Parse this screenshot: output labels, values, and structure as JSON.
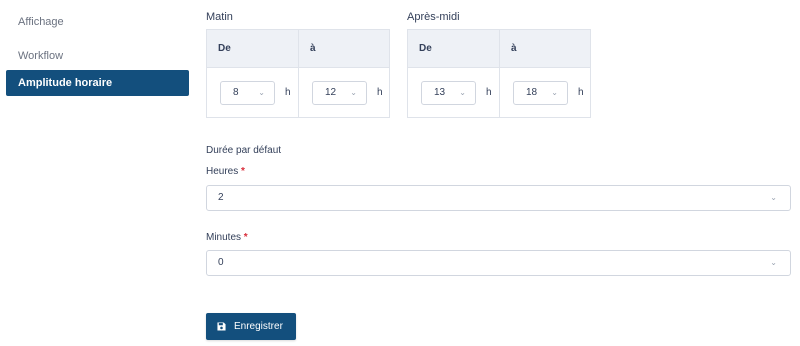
{
  "sidebar": {
    "items": [
      {
        "label": "Affichage",
        "active": false
      },
      {
        "label": "Workflow",
        "active": false
      },
      {
        "label": "Amplitude horaire",
        "active": true
      }
    ]
  },
  "schedule": {
    "morning": {
      "title": "Matin",
      "from_label": "De",
      "to_label": "à",
      "from_value": "8",
      "to_value": "12",
      "unit": "h"
    },
    "afternoon": {
      "title": "Après-midi",
      "from_label": "De",
      "to_label": "à",
      "from_value": "13",
      "to_value": "18",
      "unit": "h"
    }
  },
  "default_duration": {
    "title": "Durée par défaut",
    "hours": {
      "label": "Heures",
      "required_mark": "*",
      "value": "2"
    },
    "minutes": {
      "label": "Minutes",
      "required_mark": "*",
      "value": "0"
    }
  },
  "actions": {
    "save_label": "Enregistrer"
  },
  "icons": {
    "dropdown": "chevron-down-icon",
    "save": "floppy-disk-icon"
  },
  "colors": {
    "primary": "#134f7d",
    "required": "#d92d3a",
    "header_bg": "#eef1f6"
  }
}
